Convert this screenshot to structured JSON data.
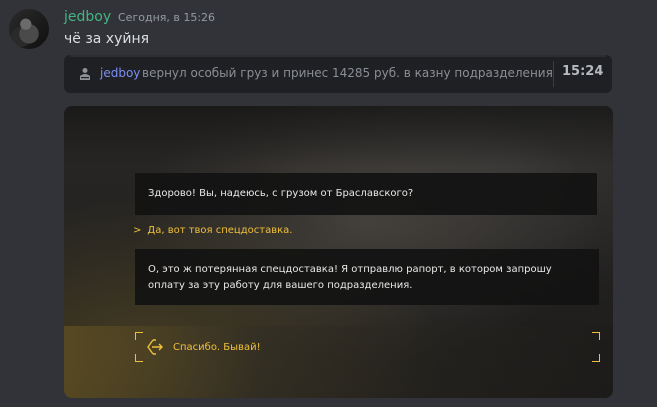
{
  "message": {
    "username": "jedboy",
    "timestamp": "Сегодня, в 15:26",
    "text": "чё за хуйня"
  },
  "embed": {
    "icon": "player-icon",
    "name": "jedboy",
    "text": "вернул особый груз и принес 14285 руб. в казну подразделения",
    "time": "15:24"
  },
  "game": {
    "npc_line_1": "Здорово! Вы, надеюсь, с грузом от Браславского?",
    "player_reply_marker": ">",
    "player_reply": "Да, вот твоя спецдоставка.",
    "npc_line_2": "О, это ж потерянная спецдоставка! Я отправлю рапорт, в котором запрошу оплату за эту работу для вашего подразделения.",
    "exit_option": "Спасибо. Бывай!",
    "accent_color": "#f0c03a"
  },
  "colors": {
    "background": "#313338",
    "username": "#43b581",
    "embed_name": "#7c8ff5"
  }
}
